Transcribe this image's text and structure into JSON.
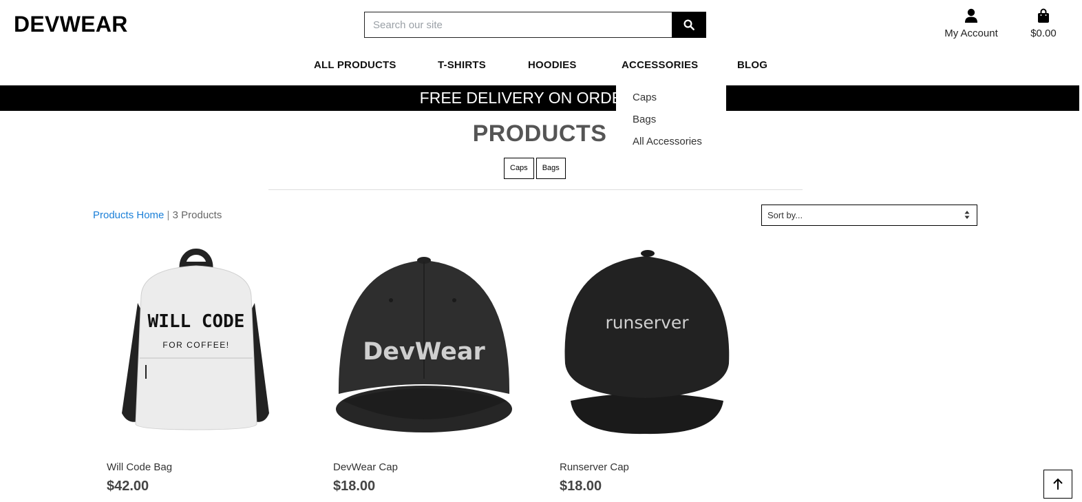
{
  "header": {
    "logo": "DEVWEAR",
    "search_placeholder": "Search our site",
    "account_label": "My Account",
    "bag_total": "$0.00"
  },
  "nav": {
    "items": [
      "ALL PRODUCTS",
      "T-SHIRTS",
      "HOODIES",
      "ACCESSORIES",
      "BLOG"
    ]
  },
  "banner": "FREE DELIVERY ON ORDERS O",
  "dropdown": {
    "items": [
      "Caps",
      "Bags",
      "All Accessories"
    ]
  },
  "page_title": "PRODUCTS",
  "category_tags": [
    "Caps",
    "Bags"
  ],
  "breadcrumb": {
    "link": "Products Home",
    "separator": "|",
    "count": "3 Products"
  },
  "sort": {
    "selected": "Sort by..."
  },
  "products": [
    {
      "name": "Will Code Bag",
      "price": "$42.00",
      "print_line1": "WILL CODE",
      "print_line2": "FOR COFFEE!"
    },
    {
      "name": "DevWear Cap",
      "price": "$18.00",
      "print_line1": "DevWear"
    },
    {
      "name": "Runserver Cap",
      "price": "$18.00",
      "print_line1": "runserver"
    }
  ],
  "icons": {
    "search": "search-icon",
    "account": "user-icon",
    "bag": "shopping-bag-icon",
    "sort": "sort-caret-icon",
    "back_to_top": "arrow-up-icon"
  },
  "colors": {
    "link": "#1a7fd8",
    "banner_bg": "#000000",
    "banner_text": "#ffffff"
  }
}
